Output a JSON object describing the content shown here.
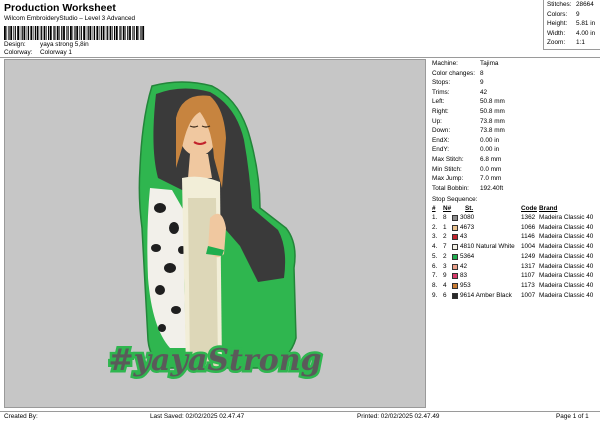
{
  "header": {
    "title": "Production Worksheet",
    "subtitle": "Wilcom EmbroideryStudio – Level 3 Advanced",
    "design_label": "Design:",
    "design_value": "yaya strong 5,8in",
    "colorway_label": "Colorway:",
    "colorway_value": "Colorway 1"
  },
  "summary": [
    {
      "label": "Stitches:",
      "value": "28664"
    },
    {
      "label": "Colors:",
      "value": "9"
    },
    {
      "label": "Height:",
      "value": "5.81 in"
    },
    {
      "label": "Width:",
      "value": "4.00 in"
    },
    {
      "label": "Zoom:",
      "value": "1:1"
    }
  ],
  "specs": [
    {
      "label": "Machine:",
      "value": "Tajima"
    },
    {
      "label": "Color changes:",
      "value": "8"
    },
    {
      "label": "Stops:",
      "value": "9"
    },
    {
      "label": "Trims:",
      "value": "42"
    },
    {
      "label": "Left:",
      "value": "50.8 mm"
    },
    {
      "label": "Right:",
      "value": "50.8 mm"
    },
    {
      "label": "Up:",
      "value": "73.8 mm"
    },
    {
      "label": "Down:",
      "value": "73.8 mm"
    },
    {
      "label": "EndX:",
      "value": "0.00 in"
    },
    {
      "label": "EndY:",
      "value": "0.00 in"
    },
    {
      "label": "Max Stitch:",
      "value": "6.8 mm"
    },
    {
      "label": "Min Stitch:",
      "value": "0.0 mm"
    },
    {
      "label": "Max Jump:",
      "value": "7.0 mm"
    },
    {
      "label": "Total Bobbin:",
      "value": "192.40ft"
    }
  ],
  "stop_sequence": {
    "title": "Stop Sequence:",
    "columns": [
      "#",
      "N#",
      "St.",
      "Code",
      "Brand"
    ],
    "rows": [
      {
        "num": "1.",
        "needle": "8",
        "color": "#8c8c8c",
        "name": "3080",
        "stitches": "1362",
        "brand": "Madeira Classic 40"
      },
      {
        "num": "2.",
        "needle": "1",
        "color": "#e9c28f",
        "name": "4673",
        "stitches": "1066",
        "brand": "Madeira Classic 40"
      },
      {
        "num": "3.",
        "needle": "2",
        "color": "#c2222c",
        "name": "43",
        "stitches": "1146",
        "brand": "Madeira Classic 40"
      },
      {
        "num": "4.",
        "needle": "7",
        "color": "#f3f1e6",
        "name": "4810  Natural White",
        "stitches": "1004",
        "brand": "Madeira Classic 40"
      },
      {
        "num": "5.",
        "needle": "2",
        "color": "#1fae4e",
        "name": "5364",
        "stitches": "1249",
        "brand": "Madeira Classic 40"
      },
      {
        "num": "6.",
        "needle": "3",
        "color": "#e9a08a",
        "name": "42",
        "stitches": "1317",
        "brand": "Madeira Classic 40"
      },
      {
        "num": "7.",
        "needle": "9",
        "color": "#d83a6b",
        "name": "83",
        "stitches": "1107",
        "brand": "Madeira Classic 40"
      },
      {
        "num": "8.",
        "needle": "4",
        "color": "#c97c33",
        "name": "953",
        "stitches": "1173",
        "brand": "Madeira Classic 40"
      },
      {
        "num": "9.",
        "needle": "6",
        "color": "#2a2a2a",
        "name": "9614  Amber Black",
        "stitches": "1007",
        "brand": "Madeira Classic 40"
      }
    ]
  },
  "design_art": {
    "text": "#yayaStrong",
    "outline_color": "#2fb64f",
    "text_color": "#5a5a5a"
  },
  "footer": {
    "created_by": "Created By:",
    "last_saved": "Last Saved: 02/02/2025 02.47.47",
    "printed": "Printed: 02/02/2025 02.47.49",
    "page": "Page 1 of 1"
  }
}
